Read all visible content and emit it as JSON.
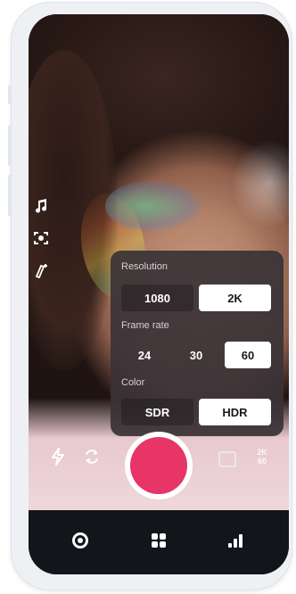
{
  "panel": {
    "resolution": {
      "title": "Resolution",
      "options": [
        "1080",
        "2K"
      ],
      "selected": "2K"
    },
    "frame_rate": {
      "title": "Frame rate",
      "options": [
        "24",
        "30",
        "60"
      ],
      "selected": "60"
    },
    "color": {
      "title": "Color",
      "options": [
        "SDR",
        "HDR"
      ],
      "selected": "HDR"
    }
  },
  "badge": {
    "line1": "2K",
    "line2": "60"
  },
  "left_tools": [
    "music-note-icon",
    "face-frame-icon",
    "beauty-wand-icon"
  ],
  "controls": [
    "flash-icon",
    "flip-camera-icon",
    "record-button",
    "gallery-icon"
  ],
  "tabs": [
    "record-tab-icon",
    "grid-tab-icon",
    "stats-tab-icon"
  ],
  "colors": {
    "record": "#e63566",
    "tabbar": "#12151a",
    "panel": "#3a3236"
  }
}
